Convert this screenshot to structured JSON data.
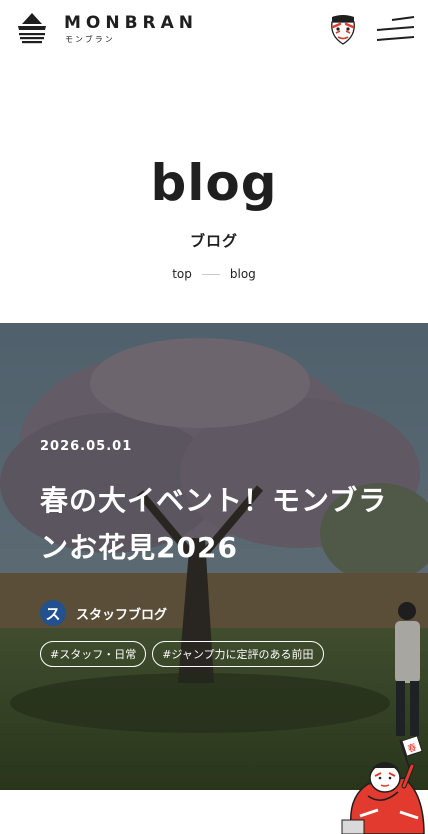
{
  "header": {
    "logo_text": "MONBRAN",
    "logo_kana": "モンブラン",
    "logo_icon": "mountain-logo-icon",
    "kabuki_icon": "kabuki-face-icon",
    "menu_icon": "hamburger-menu-icon"
  },
  "page": {
    "title": "blog",
    "subtitle": "ブログ",
    "breadcrumb": {
      "home": "top",
      "current": "blog"
    }
  },
  "hero": {
    "date": "2026.05.01",
    "title": "春の大イベント！モンブランお花見2026",
    "author": {
      "avatar_initial": "ス",
      "name": "スタッフブログ",
      "avatar_color": "#23508e"
    },
    "tags": [
      "#スタッフ・日常",
      "#ジャンプ力に定評のある前田"
    ]
  },
  "mascot": {
    "icon": "kabuki-mascot-icon",
    "flag_text": "春"
  },
  "colors": {
    "text": "#1f1f1f",
    "background": "#ffffff",
    "accent_blue": "#23508e",
    "mascot_red": "#e23a2e"
  }
}
